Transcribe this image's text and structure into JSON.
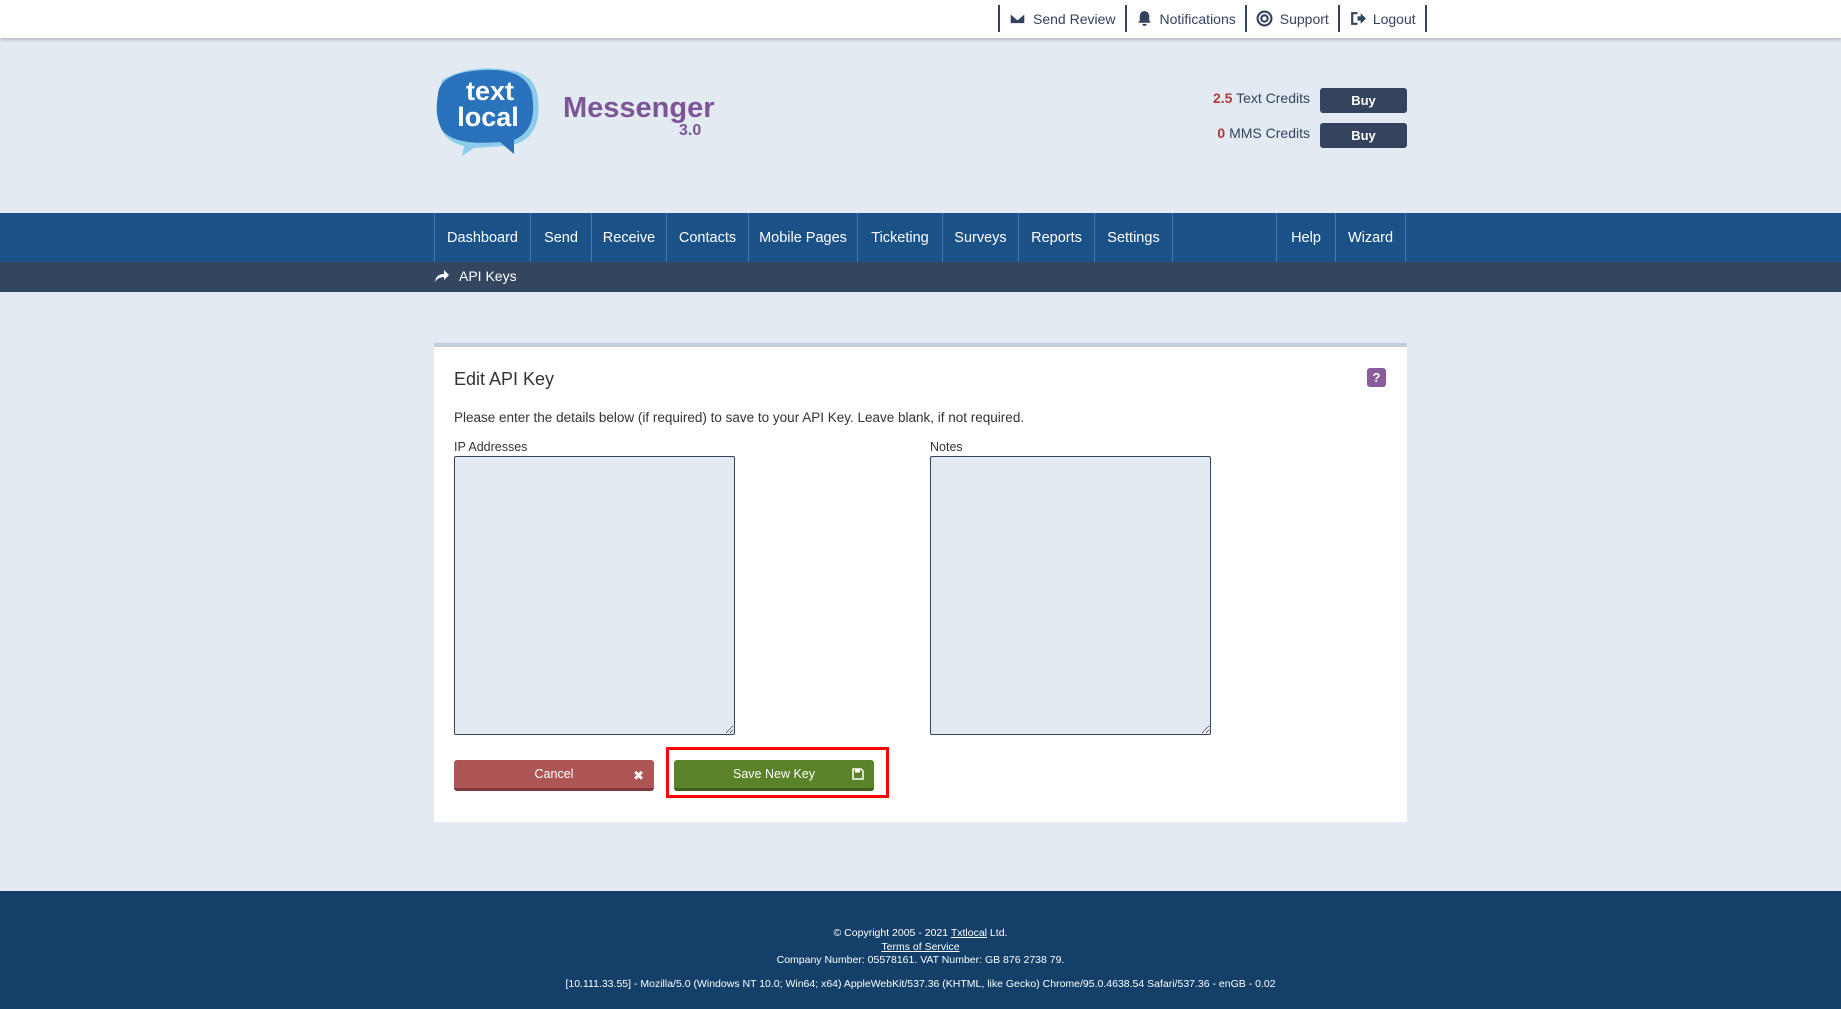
{
  "topbar": {
    "items": [
      {
        "label": "Send Review",
        "icon": "envelope-icon"
      },
      {
        "label": "Notifications",
        "icon": "bell-icon"
      },
      {
        "label": "Support",
        "icon": "lifebuoy-icon"
      },
      {
        "label": "Logout",
        "icon": "logout-icon"
      }
    ]
  },
  "header": {
    "logo_text": [
      "text",
      "local"
    ],
    "app_name": "Messenger",
    "version": "3.0",
    "credits": [
      {
        "value": "2.5",
        "label": "Text Credits",
        "button": "Buy"
      },
      {
        "value": "0",
        "label": "MMS Credits",
        "button": "Buy"
      }
    ]
  },
  "nav": {
    "items": [
      "Dashboard",
      "Send",
      "Receive",
      "Contacts",
      "Mobile Pages",
      "Ticketing",
      "Surveys",
      "Reports",
      "Settings"
    ],
    "right_items": [
      "Help",
      "Wizard"
    ]
  },
  "breadcrumb": {
    "label": "API Keys"
  },
  "form": {
    "title": "Edit API Key",
    "description": "Please enter the details below (if required) to save to your API Key. Leave blank, if not required.",
    "ip_label": "IP Addresses",
    "ip_value": "",
    "notes_label": "Notes",
    "notes_value": "",
    "help": "?",
    "cancel": "Cancel",
    "save": "Save New Key"
  },
  "footer": {
    "copyright_pre": "© Copyright 2005 - 2021 ",
    "company_link": "Txtlocal",
    "copyright_post": " Ltd.",
    "terms": "Terms of Service",
    "company_info": "Company Number: 05578161. VAT Number: GB 876 2738 79.",
    "agent": "[10.111.33.55] - Mozilla/5.0 (Windows NT 10.0; Win64; x64) AppleWebKit/537.36 (KHTML, like Gecko) Chrome/95.0.4638.54 Safari/537.36 - enGB - 0.02"
  },
  "colors": {
    "nav": "#1a5288",
    "brand_purple": "#7d5597",
    "cancel": "#ae5656",
    "save": "#5a8228",
    "highlight": "#ff0000"
  }
}
